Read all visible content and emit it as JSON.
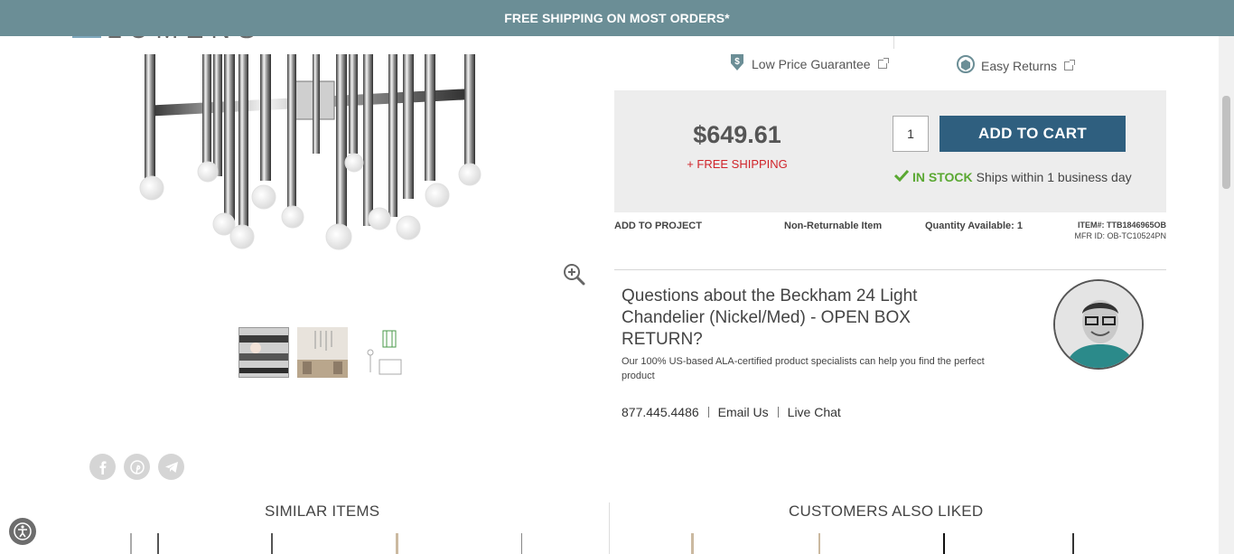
{
  "banner": {
    "text": "FREE SHIPPING ON MOST ORDERS*"
  },
  "logo": {
    "text": "LUMENS"
  },
  "trust": {
    "guarantee_label": "Low Price Guarantee",
    "returns_label": "Easy Returns"
  },
  "purchase": {
    "price": "$649.61",
    "free_shipping": "+ FREE SHIPPING",
    "quantity": "1",
    "add_to_cart": "ADD TO CART",
    "stock_status": "IN STOCK",
    "ships_text": "Ships within 1 business day"
  },
  "meta": {
    "add_to_project": "ADD TO PROJECT",
    "returnable": "Non-Returnable Item",
    "quantity_available": "Quantity Available: 1",
    "item_number": "ITEM#: TTB1846965OB",
    "mfr_id": "MFR ID: OB-TC10524PN"
  },
  "questions": {
    "title": "Questions about the Beckham 24 Light Chandelier (Nickel/Med) - OPEN BOX RETURN?",
    "subtitle": "Our 100% US-based ALA-certified product specialists can help you find the perfect product",
    "phone": "877.445.4486",
    "email": "Email Us",
    "chat": "Live Chat"
  },
  "social": [
    "facebook-icon",
    "pinterest-icon",
    "telegram-icon"
  ],
  "sections": {
    "similar": "SIMILAR ITEMS",
    "also_liked": "CUSTOMERS ALSO LIKED"
  },
  "colors": {
    "banner": "#6b8e96",
    "cart_button": "#2f5f7f",
    "free_shipping": "#d0242a",
    "in_stock": "#5aa832"
  }
}
